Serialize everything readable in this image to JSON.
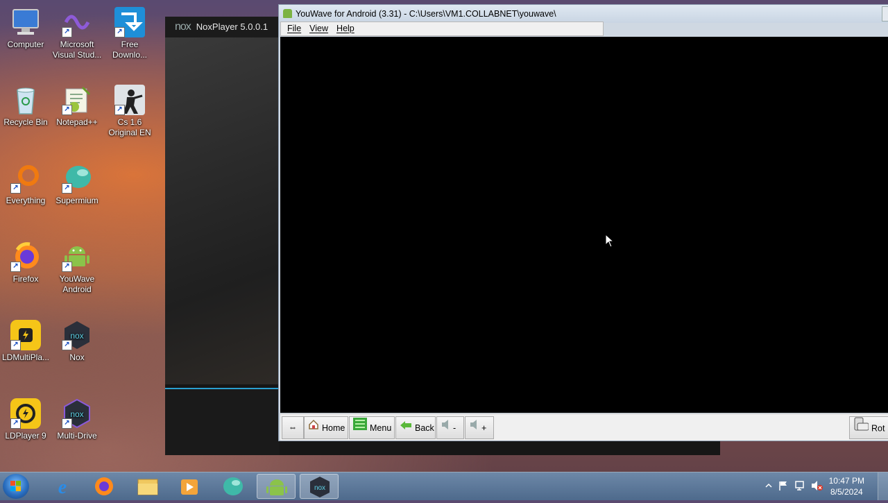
{
  "desktop_icons": [
    {
      "label": "Computer",
      "icon": "computer-icon"
    },
    {
      "label": "Microsoft Visual Stud...",
      "icon": "visual-studio-icon"
    },
    {
      "label": "Free Downlo...",
      "icon": "free-download-manager-icon"
    },
    {
      "label": "Recycle Bin",
      "icon": "recycle-bin-icon"
    },
    {
      "label": "Notepad++",
      "icon": "notepad-plus-plus-icon"
    },
    {
      "label": "Cs 1.6 Original EN",
      "icon": "counter-strike-icon"
    },
    {
      "label": "Everything",
      "icon": "everything-search-icon"
    },
    {
      "label": "Supermium",
      "icon": "supermium-icon"
    },
    {
      "label": "Firefox",
      "icon": "firefox-icon"
    },
    {
      "label": "YouWave Android",
      "icon": "android-icon"
    },
    {
      "label": "LDMultiPla...",
      "icon": "ldmultiplayer-icon"
    },
    {
      "label": "Nox",
      "icon": "nox-icon"
    },
    {
      "label": "LDPlayer 9",
      "icon": "ldplayer-icon"
    },
    {
      "label": "Multi-Drive",
      "icon": "nox-multidrive-icon"
    }
  ],
  "nox_window": {
    "logo": "nox",
    "title": "NoxPlayer 5.0.0.1"
  },
  "youwave_window": {
    "title": "YouWave for Android (3.31) - C:\\Users\\VM1.COLLABNET\\youwave\\",
    "menu": [
      "File",
      "View",
      "Help"
    ],
    "toolbar": {
      "resize_symbol": "⇔",
      "home": "Home",
      "menu": "Menu",
      "back": "Back",
      "vol_down": "-",
      "vol_up": "+",
      "rotate": "Rot"
    }
  },
  "taskbar": {
    "items": [
      {
        "icon": "internet-explorer-icon"
      },
      {
        "icon": "firefox-icon"
      },
      {
        "icon": "file-explorer-icon"
      },
      {
        "icon": "media-player-icon"
      },
      {
        "icon": "supermium-icon"
      },
      {
        "icon": "android-icon",
        "active": true
      },
      {
        "icon": "nox-icon",
        "active": true
      }
    ],
    "clock_time": "10:47 PM",
    "clock_date": "8/5/2024"
  },
  "colors": {
    "youwave_titlebar": "#c9d5e3",
    "nox_accent": "#2aa0d0",
    "taskbar": "#4e6a8c"
  }
}
